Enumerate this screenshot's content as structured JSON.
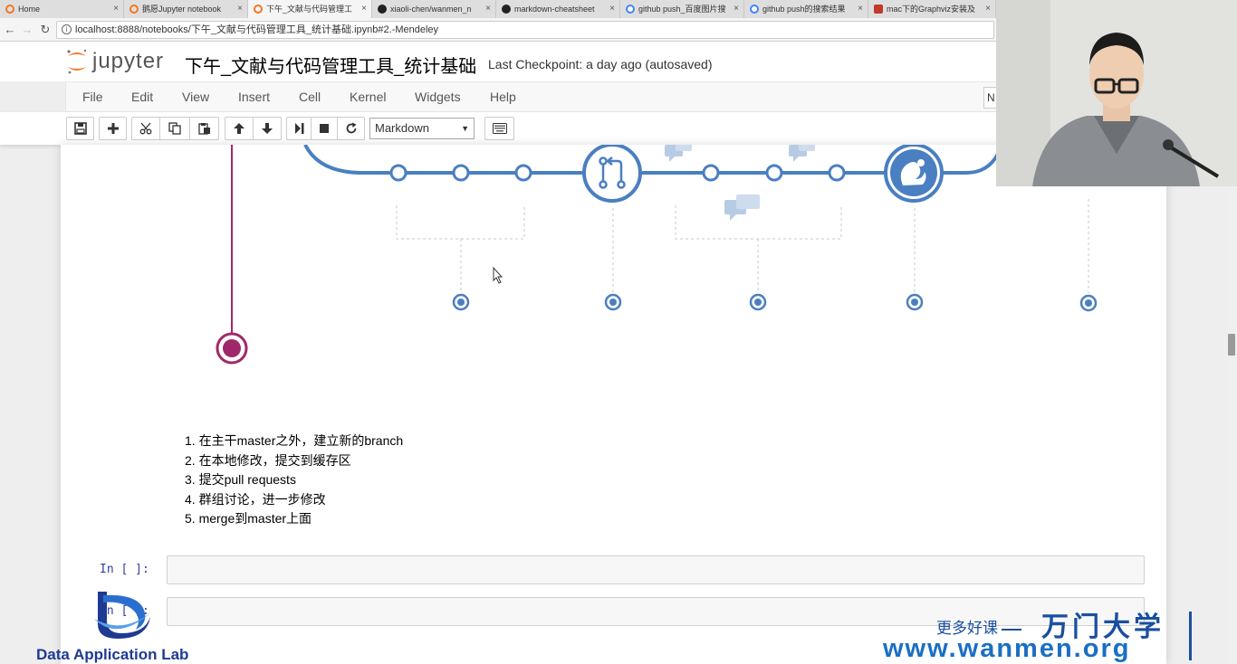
{
  "browser": {
    "tabs": [
      {
        "title": "Home",
        "icon": "jupyter-icon",
        "active": false
      },
      {
        "title": "鹅愿Jupyter notebook",
        "icon": "jupyter-icon",
        "active": false
      },
      {
        "title": "下午_文献与代码管理工",
        "icon": "jupyter-icon",
        "active": true
      },
      {
        "title": "xiaoli-chen/wanmen_n",
        "icon": "github-icon",
        "active": false
      },
      {
        "title": "markdown-cheatsheet",
        "icon": "github-icon",
        "active": false
      },
      {
        "title": "github push_百度图片搜",
        "icon": "globe-icon",
        "active": false
      },
      {
        "title": "github push的搜索结果",
        "icon": "globe-icon",
        "active": false
      },
      {
        "title": "mac下的Graphviz安装及",
        "icon": "csdn-icon",
        "active": false
      }
    ],
    "close_glyph": "×",
    "url": "localhost:8888/notebooks/下午_文献与代码管理工具_统计基础.ipynb#2.-Mendeley"
  },
  "jupyter": {
    "logo_text": "jupyter",
    "notebook_title": "下午_文献与代码管理工具_统计基础",
    "checkpoint": "Last Checkpoint: a day ago (autosaved)",
    "kernel_indicator": "N"
  },
  "menu": {
    "items": [
      "File",
      "Edit",
      "View",
      "Insert",
      "Cell",
      "Kernel",
      "Widgets",
      "Help"
    ]
  },
  "toolbar": {
    "cell_type": "Markdown",
    "buttons": [
      "save-icon",
      "plus-icon",
      "cut-icon",
      "copy-icon",
      "paste-icon",
      "arrow-up-icon",
      "arrow-down-icon",
      "run-icon",
      "stop-icon",
      "restart-icon",
      "keyboard-icon"
    ]
  },
  "markdown": {
    "steps": [
      "1. 在主干master之外，建立新的branch",
      "2. 在本地修改，提交到缓存区",
      "3. 提交pull requests",
      "4. 群组讨论，进一步修改",
      "5. merge到master上面"
    ]
  },
  "cells": [
    {
      "prompt": "In  [  ]:"
    },
    {
      "prompt": "In  [  ]:"
    }
  ],
  "watermark": {
    "org_text": "Data Application Lab",
    "slogan": "更多好课",
    "brand": "万门大学",
    "url": "www.wanmen.org"
  },
  "colors": {
    "branch_blue": "#4a7fc1",
    "master_pink": "#a0286a",
    "jupyter_orange": "#f37726",
    "prompt_blue": "#303f9f"
  }
}
